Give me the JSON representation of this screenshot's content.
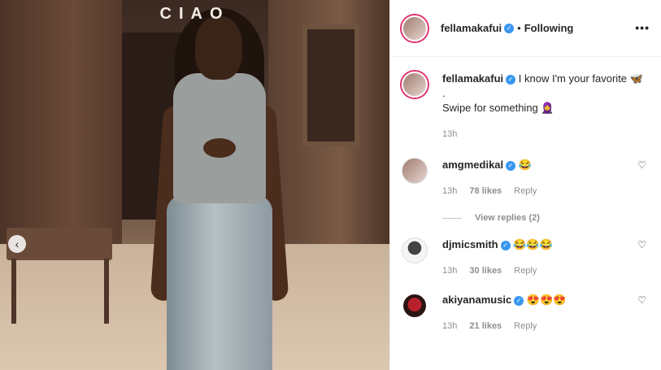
{
  "media": {
    "overlay_text": "CIAO",
    "prev_icon": "chevron-left-icon"
  },
  "post": {
    "username": "fellamakafui",
    "following_label": "Following",
    "more_icon": "•••",
    "caption_line1": "I know I'm your favorite 🦋",
    "caption_line2": ".",
    "caption_line3": "Swipe for something 🧕",
    "caption_time": "13h"
  },
  "comments": [
    {
      "username": "amgmedikal",
      "text": "😂",
      "time": "13h",
      "likes": "78 likes",
      "reply": "Reply",
      "view_replies": "View replies (2)"
    },
    {
      "username": "djmicsmith",
      "text": "😂😂😂",
      "time": "13h",
      "likes": "30 likes",
      "reply": "Reply"
    },
    {
      "username": "akiyanamusic",
      "text": "😍😍😍",
      "time": "13h",
      "likes": "21 likes",
      "reply": "Reply"
    }
  ],
  "colors": {
    "accent": "#3897f0",
    "ring": "#e1306c"
  }
}
